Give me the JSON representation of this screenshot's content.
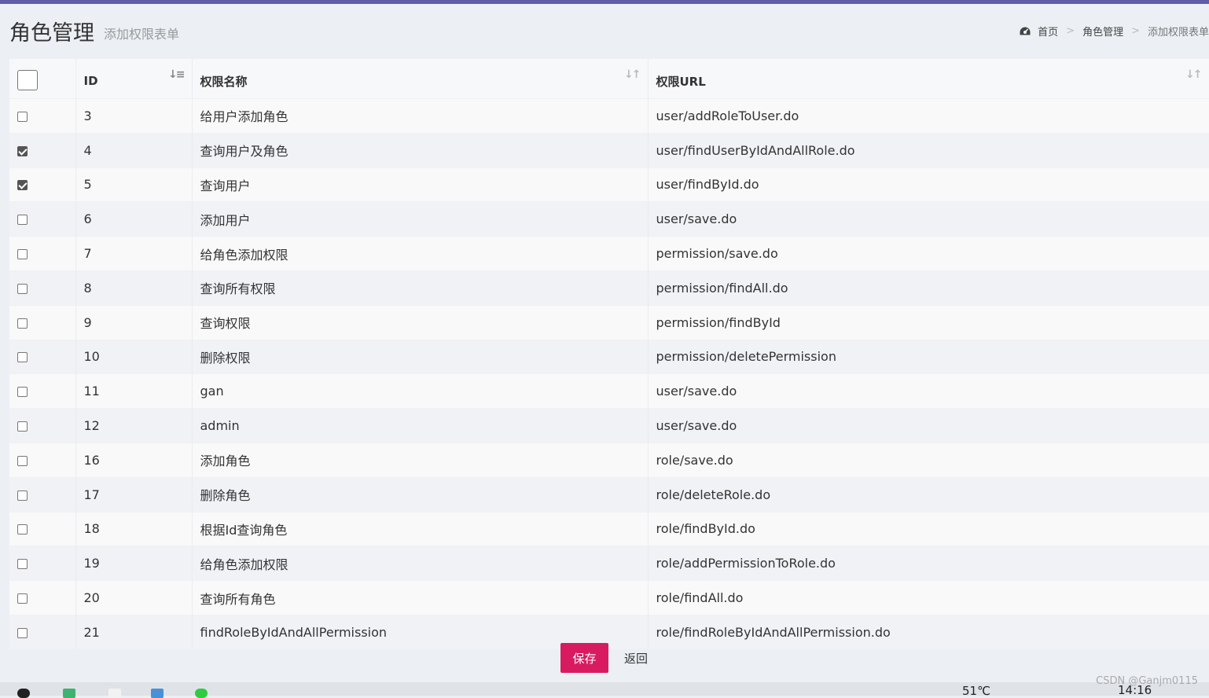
{
  "header": {
    "title": "角色管理",
    "subtitle": "添加权限表单"
  },
  "breadcrumb": {
    "home": "首页",
    "parent": "角色管理",
    "current": "添加权限表单",
    "separator": ">"
  },
  "table": {
    "columns": [
      "ID",
      "权限名称",
      "权限URL"
    ],
    "rows": [
      {
        "checked": false,
        "id": "3",
        "name": "给用户添加角色",
        "url": "user/addRoleToUser.do"
      },
      {
        "checked": true,
        "id": "4",
        "name": "查询用户及角色",
        "url": "user/findUserByIdAndAllRole.do"
      },
      {
        "checked": true,
        "id": "5",
        "name": "查询用户",
        "url": "user/findById.do"
      },
      {
        "checked": false,
        "id": "6",
        "name": "添加用户",
        "url": "user/save.do"
      },
      {
        "checked": false,
        "id": "7",
        "name": "给角色添加权限",
        "url": "permission/save.do"
      },
      {
        "checked": false,
        "id": "8",
        "name": "查询所有权限",
        "url": "permission/findAll.do"
      },
      {
        "checked": false,
        "id": "9",
        "name": "查询权限",
        "url": "permission/findById"
      },
      {
        "checked": false,
        "id": "10",
        "name": "删除权限",
        "url": "permission/deletePermission"
      },
      {
        "checked": false,
        "id": "11",
        "name": "gan",
        "url": "user/save.do"
      },
      {
        "checked": false,
        "id": "12",
        "name": "admin",
        "url": "user/save.do"
      },
      {
        "checked": false,
        "id": "16",
        "name": "添加角色",
        "url": "role/save.do"
      },
      {
        "checked": false,
        "id": "17",
        "name": "删除角色",
        "url": "role/deleteRole.do"
      },
      {
        "checked": false,
        "id": "18",
        "name": "根据Id查询角色",
        "url": "role/findById.do"
      },
      {
        "checked": false,
        "id": "19",
        "name": "给角色添加权限",
        "url": "role/addPermissionToRole.do"
      },
      {
        "checked": false,
        "id": "20",
        "name": "查询所有角色",
        "url": "role/findAll.do"
      },
      {
        "checked": false,
        "id": "21",
        "name": "findRoleByIdAndAllPermission",
        "url": "role/findRoleByIdAndAllPermission.do"
      }
    ]
  },
  "buttons": {
    "save": "保存",
    "back": "返回"
  },
  "taskbar": {
    "temperature": "51℃",
    "clock": "14:16"
  },
  "watermark": "CSDN @Ganjm0115",
  "colors": {
    "topbar": "#605ca8",
    "save_button": "#d81b60",
    "background": "#ecf0f5"
  }
}
